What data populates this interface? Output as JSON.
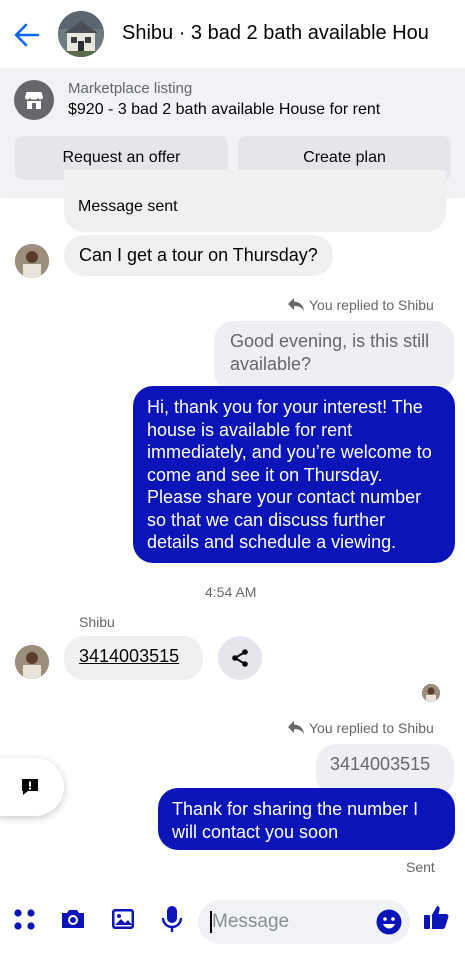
{
  "header": {
    "title": "Shibu · 3 bad 2 bath available Hou"
  },
  "marketplace": {
    "label": "Marketplace listing",
    "title": "$920 - 3 bad 2 bath available House for rent",
    "request_offer": "Request an offer",
    "create_plan": "Create plan"
  },
  "messages": {
    "partial_top": "Message sent",
    "tour_question": "Can I get a tour on Thursday?",
    "reply_note_1": "You replied to Shibu",
    "quoted_1": "Good evening, is this still available?",
    "reply_long": "Hi, thank you for your interest! The house is available for rent immediately, and you’re welcome to come and see it on Thursday. Please share your contact number so that we can discuss further details and schedule a viewing.",
    "timestamp": "4:54 AM",
    "sender_name": "Shibu",
    "phone": "3414003515",
    "reply_note_2": "You replied to Shibu",
    "quoted_2": "3414003515",
    "reply_short": "Thank for sharing  the number I will contact you soon",
    "status": "Sent"
  },
  "composer": {
    "placeholder": "Message"
  },
  "colors": {
    "outgoing": "#0a14b8",
    "accent": "#0866ff",
    "incoming": "#f0f0f0"
  },
  "icons": [
    "back-arrow-icon",
    "store-icon",
    "share-icon",
    "reply-icon",
    "feedback-icon",
    "apps-icon",
    "camera-icon",
    "image-icon",
    "mic-icon",
    "emoji-icon",
    "thumbs-up-icon"
  ]
}
